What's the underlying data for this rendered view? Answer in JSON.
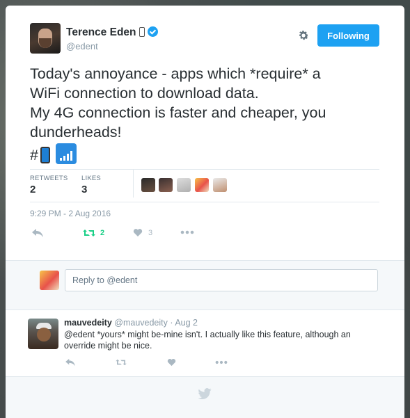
{
  "author": {
    "name": "Terence Eden",
    "handle": "@edent"
  },
  "follow_button": "Following",
  "tweet": {
    "lines": [
      "Today's annoyance - apps which *require* a",
      "WiFi connection to download data.",
      "My 4G connection is faster and cheaper, you",
      "dunderheads!"
    ],
    "hash": "#"
  },
  "stats": {
    "retweets_label": "RETWEETS",
    "retweets": "2",
    "likes_label": "LIKES",
    "likes": "3"
  },
  "timestamp": "9:29 PM - 2 Aug 2016",
  "actions": {
    "retweet_count": "2",
    "like_count": "3"
  },
  "reply_box": {
    "placeholder": "Reply to @edent"
  },
  "reply": {
    "name": "mauvedeity",
    "handle": "@mauvedeity",
    "date": "· Aug 2",
    "text": "@edent *yours* might be-mine isn't. I actually like this feature, although an override might be nice."
  },
  "colors": {
    "accent": "#1da1f2",
    "retweet_green": "#19cf86",
    "icon_gray": "#aab8c2"
  }
}
